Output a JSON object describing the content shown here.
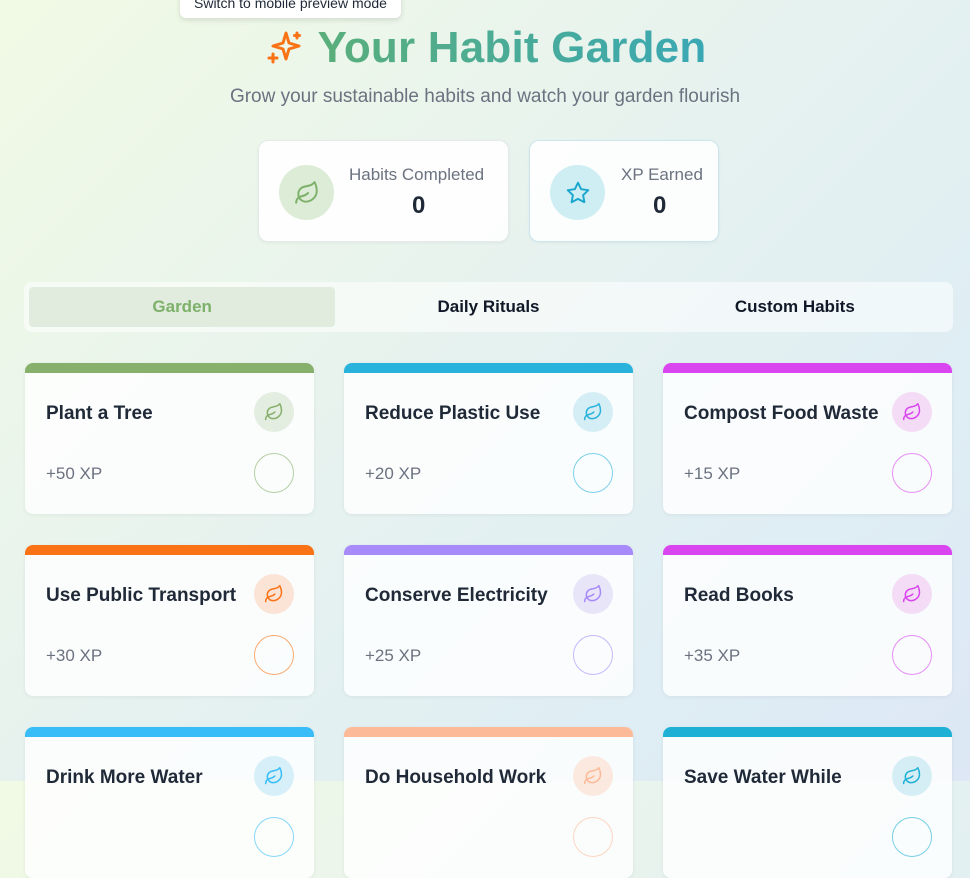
{
  "tooltip": "Switch to mobile preview mode",
  "header": {
    "title": "Your Habit Garden",
    "subtitle": "Grow your sustainable habits and watch your garden flourish"
  },
  "stats": {
    "completed": {
      "label": "Habits Completed",
      "value": "0",
      "icon": "leaf-icon"
    },
    "xp": {
      "label": "XP Earned",
      "value": "0",
      "icon": "star-icon"
    }
  },
  "tabs": [
    {
      "label": "Garden",
      "active": true
    },
    {
      "label": "Daily Rituals",
      "active": false
    },
    {
      "label": "Custom Habits",
      "active": false
    }
  ],
  "habits": [
    {
      "name": "Plant a Tree",
      "xp": "+50 XP",
      "color": "#86b06b",
      "tint": "#e3ede0"
    },
    {
      "name": "Reduce Plastic Use",
      "xp": "+20 XP",
      "color": "#29b2dc",
      "tint": "#d5eef6"
    },
    {
      "name": "Compost Food Waste",
      "xp": "+15 XP",
      "color": "#d946ef",
      "tint": "#f4dcf6"
    },
    {
      "name": "Use Public Transport",
      "xp": "+30 XP",
      "color": "#f97316",
      "tint": "#fbe3d6"
    },
    {
      "name": "Conserve Electricity",
      "xp": "+25 XP",
      "color": "#a78bfa",
      "tint": "#e9e5f9"
    },
    {
      "name": "Read Books",
      "xp": "+35 XP",
      "color": "#d946ef",
      "tint": "#f4dcf6"
    },
    {
      "name": "Drink More Water",
      "xp": "",
      "color": "#38bdf8",
      "tint": "#d6eff9"
    },
    {
      "name": "Do Household Work",
      "xp": "",
      "color": "#fdba99",
      "tint": "#fbe9e0"
    },
    {
      "name": "Save Water While",
      "xp": "",
      "color": "#1fb0d6",
      "tint": "#d5eef6"
    }
  ],
  "colors": {
    "accent_green": "#7db16a",
    "title_gradient_start": "#5aae7a",
    "title_gradient_end": "#3aa8b4",
    "spark": "#f97316"
  }
}
